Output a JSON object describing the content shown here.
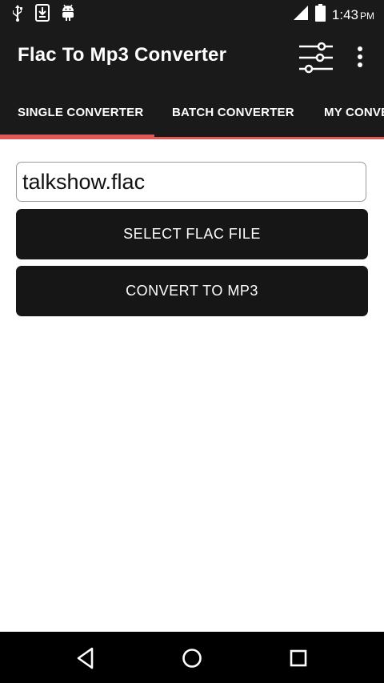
{
  "status_bar": {
    "time": "1:43",
    "ampm": "PM",
    "left_icons": [
      "usb-icon",
      "download-icon",
      "android-icon"
    ],
    "right_icons": [
      "signal-icon",
      "battery-icon"
    ]
  },
  "app_bar": {
    "title": "Flac To Mp3 Converter",
    "icons": [
      "settings-sliders-icon",
      "more-vert-icon"
    ]
  },
  "tabs": [
    {
      "label": "SINGLE CONVERTER",
      "selected": true
    },
    {
      "label": "BATCH CONVERTER",
      "selected": false
    },
    {
      "label": "MY CONVERSIONS",
      "selected": false
    }
  ],
  "main": {
    "file_name": "talkshow.flac",
    "select_button": "SELECT FLAC FILE",
    "convert_button": "CONVERT TO MP3"
  },
  "nav_bar": {
    "icons": [
      "back-icon",
      "home-icon",
      "recents-icon"
    ]
  },
  "colors": {
    "bar_background": "#1a1a1a",
    "tab_indicator": "#e05858",
    "button_background": "#161616"
  }
}
